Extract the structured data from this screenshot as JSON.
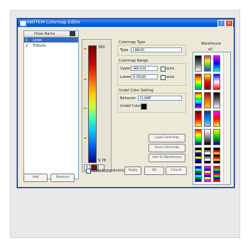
{
  "window": {
    "title": "MATFEM Colormap Editor",
    "help": "?",
    "close": "×"
  },
  "list": {
    "header": "Draw Name",
    "rows": [
      {
        "num": "1",
        "name": "Lines"
      },
      {
        "num": "2",
        "name": "TriSurfs"
      }
    ],
    "add_label": "Add",
    "remove_label": "Remove"
  },
  "colorbar": {
    "max": "380",
    "min": "9.78",
    "add": "+",
    "remove": "-"
  },
  "type_group": {
    "label": "Colormap Type",
    "type_label": "Type",
    "type_value": "LINEAR"
  },
  "range_group": {
    "label": "Colormap Range",
    "upper_label": "Upper",
    "upper_value": "380.014",
    "lower_label": "Lower",
    "lower_value": "9.78185",
    "auto_label": "auto"
  },
  "undef_group": {
    "label": "Undef Color Setting",
    "behavior_label": "Behavior",
    "behavior_value": "CLAMP",
    "color_label": "Undef Color"
  },
  "buttons": {
    "load": "Load Colormap",
    "save": "Save Colormap",
    "add_warehouse": "Add To Warehouse",
    "apply": "Apply",
    "ok": "OK",
    "cancel": "Cancel",
    "immediate": "Apply Immediately"
  },
  "warehouse": {
    "label": "Warehouse",
    "subtitle": "all"
  }
}
